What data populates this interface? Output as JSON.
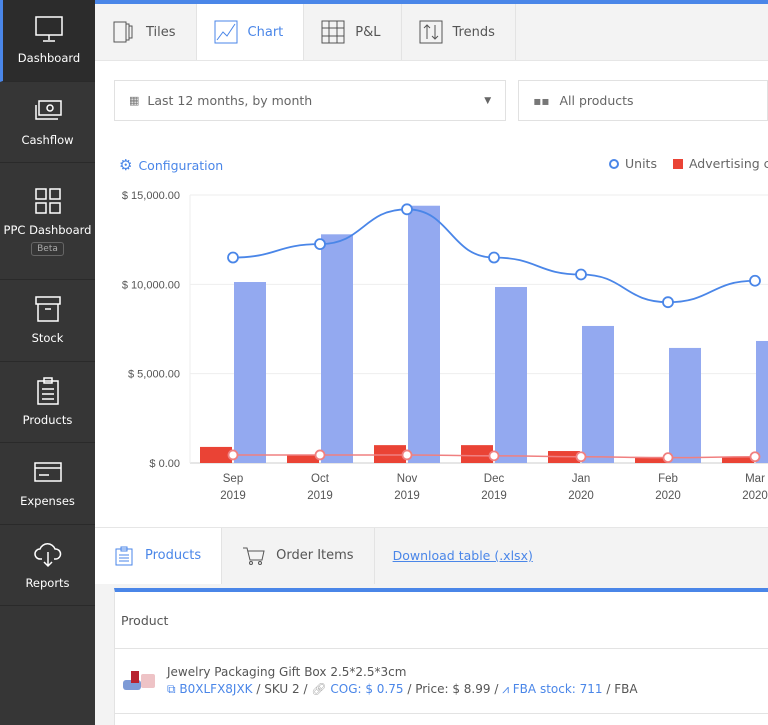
{
  "sidebar": {
    "items": [
      {
        "label": "Dashboard",
        "icon": "monitor-icon"
      },
      {
        "label": "Cashflow",
        "icon": "cash-icon"
      },
      {
        "label": "PPC Dashboard",
        "badge": "Beta",
        "icon": "grid-icon"
      },
      {
        "label": "Stock",
        "icon": "box-icon"
      },
      {
        "label": "Products",
        "icon": "clipboard-icon"
      },
      {
        "label": "Expenses",
        "icon": "card-icon"
      },
      {
        "label": "Reports",
        "icon": "cloud-download-icon"
      }
    ]
  },
  "tabs": [
    {
      "label": "Tiles"
    },
    {
      "label": "Chart",
      "active": true
    },
    {
      "label": "P&L"
    },
    {
      "label": "Trends"
    }
  ],
  "filters": {
    "period": "Last 12 months, by month",
    "products": "All products"
  },
  "chart": {
    "config_label": "Configuration",
    "legend": [
      "Units",
      "Advertising co"
    ]
  },
  "colors": {
    "accent": "#4a86e8",
    "bar_blue": "#93a9f0",
    "bar_red": "#ea4335",
    "line_pink": "#f08080"
  },
  "chart_data": {
    "type": "bar",
    "categories": [
      "Sep 2019",
      "Oct 2019",
      "Nov 2019",
      "Dec 2019",
      "Jan 2020",
      "Feb 2020",
      "Mar 2020"
    ],
    "cat_month": [
      "Sep",
      "Oct",
      "Nov",
      "Dec",
      "Jan",
      "Feb",
      "Mar"
    ],
    "cat_year": [
      "2019",
      "2019",
      "2019",
      "2019",
      "2020",
      "2020",
      "2020"
    ],
    "ylim": [
      0,
      15000
    ],
    "yticks": [
      "$ 0.00",
      "$ 5,000.00",
      "$ 10,000.00",
      "$ 15,000.00"
    ],
    "ytick_values": [
      0,
      5000,
      10000,
      15000
    ],
    "grid": true,
    "legend_position": "top-right",
    "series": [
      {
        "type": "bar",
        "color": "#ea4335",
        "values": [
          900,
          450,
          1000,
          1000,
          670,
          340,
          340
        ]
      },
      {
        "type": "bar",
        "color": "#93a9f0",
        "values": [
          10130,
          12800,
          14400,
          9850,
          7670,
          6440,
          6830
        ]
      },
      {
        "type": "line",
        "name": "Units",
        "color": "#4a86e8",
        "values": [
          11500,
          12250,
          14200,
          11500,
          10550,
          9000,
          10200
        ]
      },
      {
        "type": "line",
        "color": "#f08080",
        "values": [
          450,
          450,
          450,
          400,
          350,
          300,
          350
        ]
      }
    ]
  },
  "bottom": {
    "tabs": [
      {
        "label": "Products"
      },
      {
        "label": "Order Items"
      }
    ],
    "download": "Download table (.xlsx)"
  },
  "table": {
    "header": "Product",
    "rows": [
      {
        "name": "Jewelry Packaging Gift Box 2.5*2.5*3cm",
        "asin": "B0XLFX8JXK",
        "sku": " / SKU 2 / ",
        "cog": "COG: $ 0.75",
        "price": " / Price: $ 8.99 / ",
        "stock": "FBA stock: 711",
        "fulfil": " / FBA"
      }
    ]
  }
}
